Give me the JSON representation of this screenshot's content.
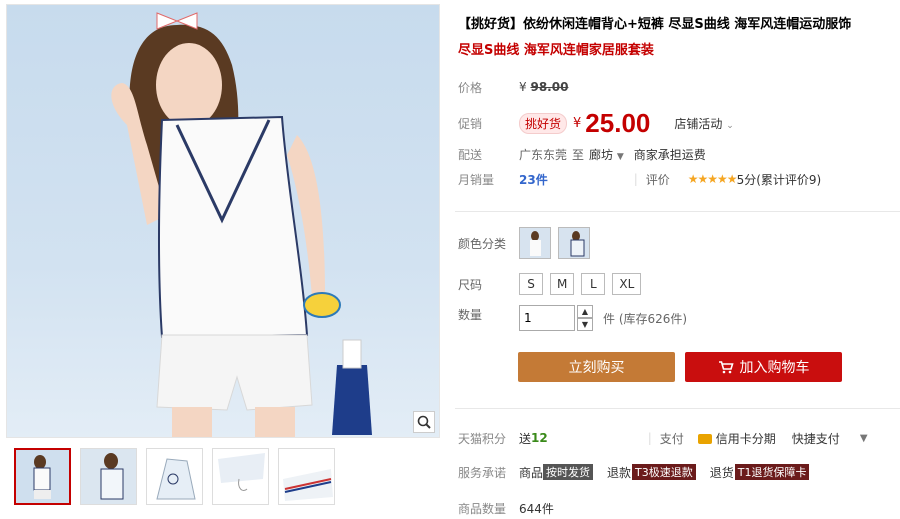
{
  "product": {
    "title": "【挑好货】依纷休闲连帽背心+短裤 尽显S曲线 海军风连帽运动服饰",
    "subtitle": "尽显S曲线 海军风连帽家居服套装"
  },
  "price": {
    "label": "价格",
    "currency": "¥",
    "original": "98.00",
    "promo_label": "促销",
    "promo_tag": "挑好货",
    "promo_price": "25.00",
    "activity": "店铺活动"
  },
  "shipping": {
    "label": "配送",
    "from": "广东东莞",
    "to_word": "至",
    "to": "廊坊",
    "fee": "商家承担运费"
  },
  "sales": {
    "label": "月销量",
    "count": "23件",
    "rating_label": "评价",
    "stars": "★★★★★",
    "rating_text": "5分(累计评价9)"
  },
  "sku": {
    "color_label": "颜色分类",
    "size_label": "尺码",
    "sizes": [
      "S",
      "M",
      "L",
      "XL"
    ],
    "qty_label": "数量",
    "qty_value": "1",
    "stock_text": "件 (库存626件)"
  },
  "actions": {
    "buy_now": "立刻购买",
    "add_cart": "加入购物车"
  },
  "footer": {
    "points_label": "天猫积分",
    "points_prefix": "送",
    "points_value": "12",
    "pay_label": "支付",
    "pay_card": "信用卡分期",
    "pay_quick": "快捷支付",
    "service_label": "服务承诺",
    "svc1_text": "商品",
    "svc1_badge": "按时发货",
    "svc2_text": "退款",
    "svc2_badge": "T3极速退款",
    "svc3_text": "退货",
    "svc3_badge": "T1退货保障卡",
    "count_label": "商品数量",
    "count_value": "644件"
  },
  "icons": {
    "zoom": "magnifier-icon",
    "cart": "cart-icon",
    "dropdown": "chevron-down-icon",
    "card": "credit-card-icon"
  },
  "colors": {
    "accent_red": "#c40000",
    "buy_brown": "#c47a36",
    "cart_red": "#c90e0e"
  }
}
